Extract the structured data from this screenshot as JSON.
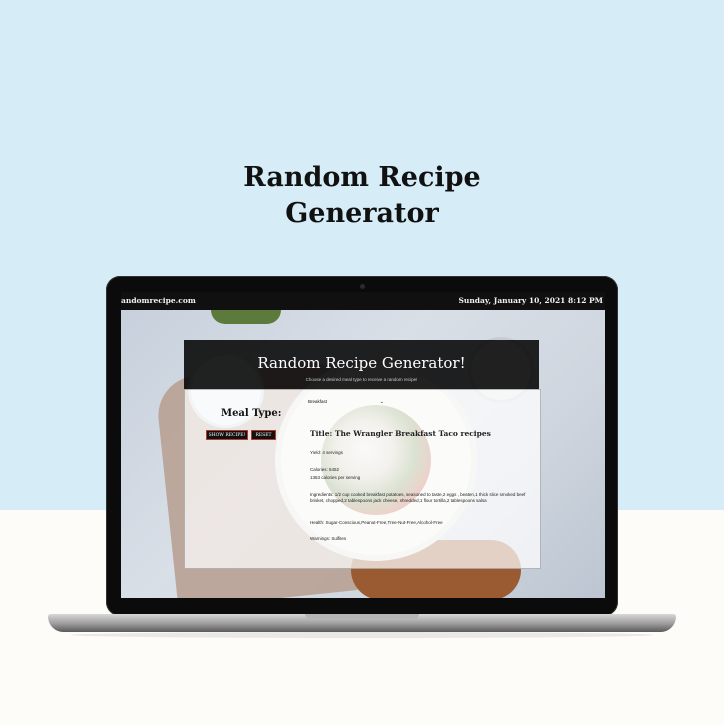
{
  "poster": {
    "heading_line1": "Random Recipe",
    "heading_line2": "Generator"
  },
  "browser": {
    "site": "andomrecipe.com",
    "datetime": "Sunday, January 10, 2021 8:12 PM"
  },
  "app": {
    "title": "Random Recipe Generator!",
    "subtitle": "Choose a desired meal type to receive a random recipe!",
    "meal_type_label": "Meal Type:",
    "show_button": "SHOW RECIPE!",
    "reset_button": "RESET",
    "meal_select_value": "Breakfast"
  },
  "recipe": {
    "title": "Title: The Wrangler Breakfast Taco recipes",
    "yield": "Yield: 4 servings",
    "calories": "Calories: 5452",
    "per_serving": "1363 calories per serving",
    "ingredients": "Ingredients: 1/2 cup cooked breakfast potatoes, seasoned to taste,2 eggs , beaten,1 thick slice smoked beef brisket, chopped,2 tablespoons jack cheese, shredded,1 flour tortilla,2 tablespoons salsa",
    "health": "Health: Sugar-Conscious,Peanut-Free,Tree-Nut-Free,Alcohol-Free",
    "warnings": "Warnings: Sulfites"
  },
  "colors": {
    "sky": "#d6ecf7",
    "accent": "#b23b2b"
  }
}
